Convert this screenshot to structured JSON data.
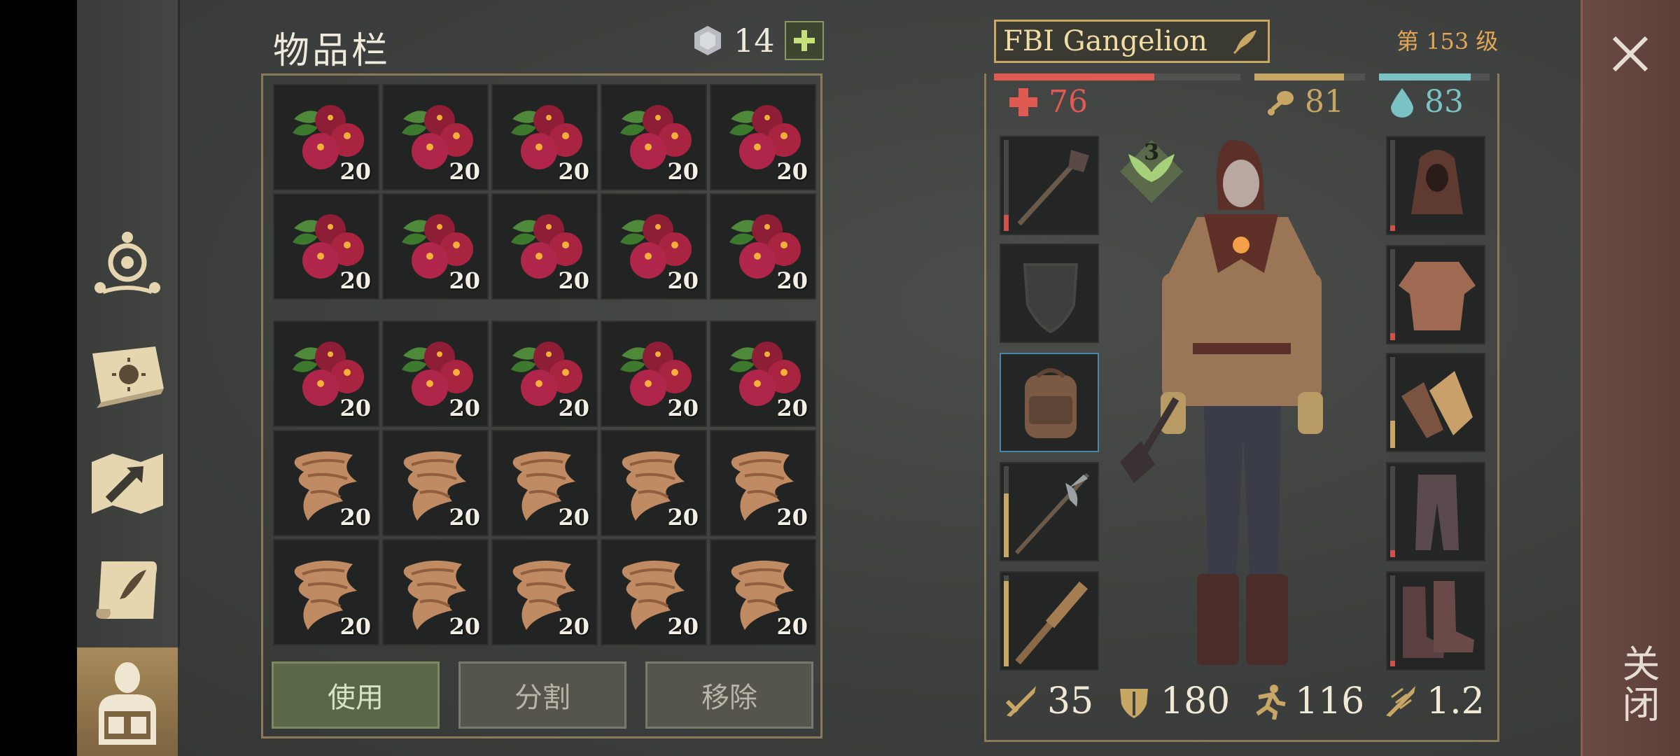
{
  "inventory": {
    "title": "物品栏",
    "currency_count": "14",
    "slots": [
      {
        "item": "berries",
        "qty": "20"
      },
      {
        "item": "berries",
        "qty": "20"
      },
      {
        "item": "berries",
        "qty": "20"
      },
      {
        "item": "berries",
        "qty": "20"
      },
      {
        "item": "berries",
        "qty": "20"
      },
      {
        "item": "berries",
        "qty": "20"
      },
      {
        "item": "berries",
        "qty": "20"
      },
      {
        "item": "berries",
        "qty": "20"
      },
      {
        "item": "berries",
        "qty": "20"
      },
      {
        "item": "berries",
        "qty": "20"
      },
      {
        "item": "berries",
        "qty": "20"
      },
      {
        "item": "berries",
        "qty": "20"
      },
      {
        "item": "berries",
        "qty": "20"
      },
      {
        "item": "berries",
        "qty": "20"
      },
      {
        "item": "berries",
        "qty": "20"
      },
      {
        "item": "cloth-scraps",
        "qty": "20"
      },
      {
        "item": "cloth-scraps",
        "qty": "20"
      },
      {
        "item": "cloth-scraps",
        "qty": "20"
      },
      {
        "item": "cloth-scraps",
        "qty": "20"
      },
      {
        "item": "cloth-scraps",
        "qty": "20"
      },
      {
        "item": "cloth-scraps",
        "qty": "20"
      },
      {
        "item": "cloth-scraps",
        "qty": "20"
      },
      {
        "item": "cloth-scraps",
        "qty": "20"
      },
      {
        "item": "cloth-scraps",
        "qty": "20"
      },
      {
        "item": "cloth-scraps",
        "qty": "20"
      }
    ],
    "buttons": {
      "use": "使用",
      "split": "分割",
      "remove": "移除"
    }
  },
  "character": {
    "name": "FBI Gangelion",
    "level": "第 153 级",
    "health": "76",
    "health_fraction": 0.65,
    "food": "81",
    "food_fraction": 0.81,
    "water": "83",
    "water_fraction": 0.83,
    "skill_badge": "3",
    "stats": {
      "attack": "35",
      "defense": "180",
      "speed": "116",
      "attack_speed": "1.2"
    },
    "left_equipment": [
      "mace",
      "shield-empty",
      "backpack",
      "halberd",
      "spiked-club"
    ],
    "right_equipment": [
      "hood",
      "padded-jacket",
      "gloves",
      "pants",
      "boots"
    ]
  },
  "nav": {
    "items": [
      "clan-icon",
      "recipes-book-icon",
      "map-icon",
      "quest-scroll-icon",
      "character-icon"
    ],
    "active": "character-icon"
  },
  "close_label": "关闭",
  "colors": {
    "health": "#e05a52",
    "food": "#c8a664",
    "water": "#7ac2c4",
    "accent_gold": "#c8a664"
  }
}
